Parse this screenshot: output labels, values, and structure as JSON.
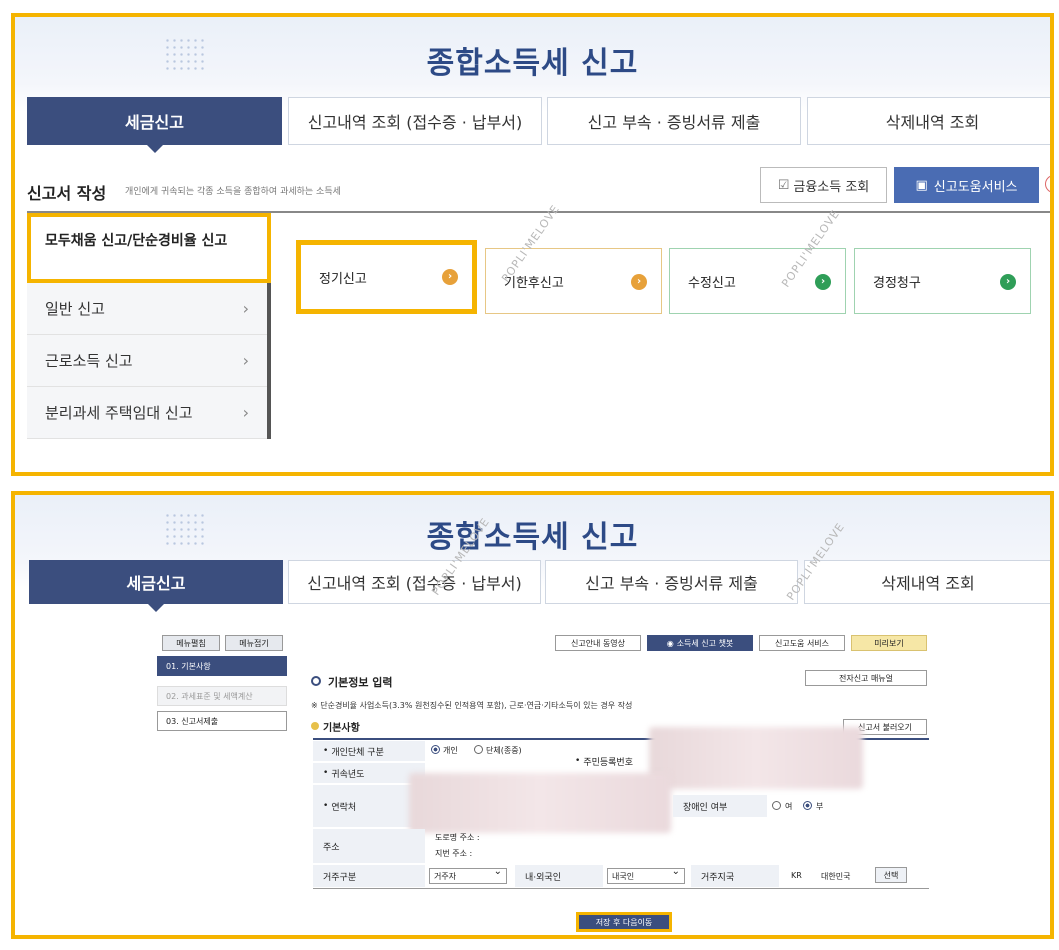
{
  "page_title": "종합소득세 신고",
  "tabs": [
    "세금신고",
    "신고내역 조회 (접수증 · 납부서)",
    "신고 부속 · 증빙서류 제출",
    "삭제내역 조회"
  ],
  "watermark": "POPLI'MELOVE",
  "panel1": {
    "section_title": "신고서 작성",
    "section_desc": "개인에게 귀속되는 각종 소득을 종합하여 과세하는 소득세",
    "btn_finance": "금융소득 조회",
    "btn_help": "신고도움서비스",
    "help_icon": "?",
    "side_items": [
      "모두채움 신고/단순경비율 신고",
      "일반 신고",
      "근로소득 신고",
      "분리과세 주택임대 신고"
    ],
    "cards": [
      "정기신고",
      "기한후신고",
      "수정신고",
      "경정청구"
    ]
  },
  "panel2": {
    "menu_btns": [
      "메뉴펼침",
      "메뉴접기"
    ],
    "steps": [
      "01. 기본사항",
      "02. 과세표준 및 세액계산",
      "03. 신고서제출"
    ],
    "top_btns": [
      "신고안내 동영상",
      "소득세 신고 챗봇",
      "신고도움 서비스",
      "미리보기"
    ],
    "basic_title": "기본정보 입력",
    "manual_btn": "전자신고 매뉴얼",
    "note": "※ 단순경비율 사업소득(3.3% 원천징수된 인적용역 포함), 근로·연금·기타소득이 있는 경우 작성",
    "sub_title": "기본사항",
    "load_btn": "신고서 불러오기",
    "labels": {
      "type": "개인단체 구분",
      "year": "귀속년도",
      "contact": "연락처",
      "rrn": "주민등록번호",
      "address": "주소",
      "disabled": "장애인 여부",
      "residence": "거주구분",
      "domestic": "내·외국인",
      "country": "거주지국"
    },
    "radio_individual": "개인",
    "radio_group": "단체(종중)",
    "addr_road": "도로명 주소 :",
    "addr_lot": "지번 주소 :",
    "disabled_yes": "여",
    "disabled_no": "부",
    "residence_val": "거주자",
    "domestic_val": "내국인",
    "country_code": "KR",
    "country_name": "대한민국",
    "select_btn": "선택",
    "save_btn": "저장 후 다음이동"
  },
  "colors": {
    "navy": "#3b4e7e",
    "highlight": "#f5b400",
    "orange": "#e7a13a",
    "green": "#2f9e58"
  }
}
